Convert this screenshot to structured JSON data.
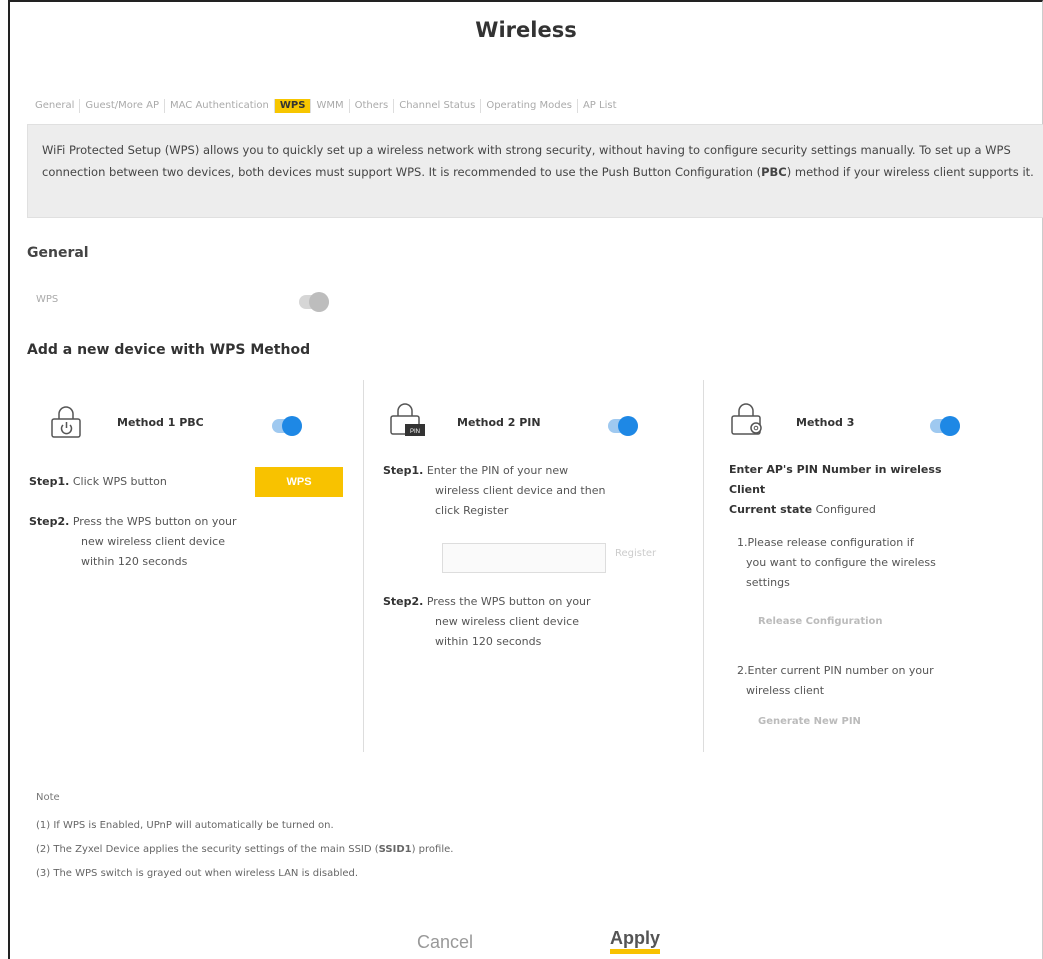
{
  "page": {
    "title": "Wireless"
  },
  "tabs": [
    {
      "label": "General",
      "active": false
    },
    {
      "label": "Guest/More AP",
      "active": false
    },
    {
      "label": "MAC Authentication",
      "active": false
    },
    {
      "label": "WPS",
      "active": true
    },
    {
      "label": "WMM",
      "active": false
    },
    {
      "label": "Others",
      "active": false
    },
    {
      "label": "Channel Status",
      "active": false
    },
    {
      "label": "Operating Modes",
      "active": false
    },
    {
      "label": "AP List",
      "active": false
    }
  ],
  "description": {
    "part1": "WiFi Protected Setup (WPS) allows you to quickly set up a wireless network with strong security, without having to configure security settings manually. To set up a WPS connection between two devices, both devices must support WPS. It is recommended to use the Push Button Configuration (",
    "bold": "PBC",
    "part2": ") method if your wireless client supports it."
  },
  "general": {
    "heading": "General",
    "wps_label": "WPS",
    "wps_enabled": false
  },
  "add_device": {
    "heading": "Add a new device with WPS Method",
    "method1": {
      "title": "Method 1 PBC",
      "enabled": true,
      "step1_label": "Step1.",
      "step1_text": "Click WPS button",
      "wps_button": "WPS",
      "step2_label": "Step2.",
      "step2_text_a": "Press the WPS button on your",
      "step2_text_b": "new wireless client device",
      "step2_text_c": "within 120 seconds"
    },
    "method2": {
      "title": "Method 2 PIN",
      "enabled": true,
      "step1_label": "Step1.",
      "step1_text_a": "Enter the PIN of your new",
      "step1_text_b": "wireless client device and then",
      "step1_text_c": "click Register",
      "pin_value": "",
      "register_button": "Register",
      "step2_label": "Step2.",
      "step2_text_a": "Press the WPS button on your",
      "step2_text_b": "new wireless client device",
      "step2_text_c": "within 120 seconds"
    },
    "method3": {
      "title": "Method 3",
      "enabled": true,
      "heading_a": "Enter AP's PIN Number in wireless",
      "heading_b": "Client",
      "current_state_label": "Current state",
      "current_state_value": "Configured",
      "item1_a": "1.Please release configuration if",
      "item1_b": "you want to configure the wireless",
      "item1_c": "settings",
      "release_button": "Release Configuration",
      "item2_a": "2.Enter current PIN number on your",
      "item2_b": "wireless client",
      "generate_button": "Generate New PIN"
    }
  },
  "note": {
    "title": "Note",
    "line1": "(1) If WPS is Enabled, UPnP will automatically be turned on.",
    "line2a": "(2) The Zyxel Device applies the security settings of the main SSID (",
    "line2b": "SSID1",
    "line2c": ") profile.",
    "line3": "(3) The WPS switch is grayed out when wireless LAN is disabled."
  },
  "footer": {
    "cancel": "Cancel",
    "apply": "Apply"
  },
  "colors": {
    "accent": "#f8c200",
    "toggle_on": "#1e88e5",
    "toggle_off": "#bdbdbd"
  }
}
